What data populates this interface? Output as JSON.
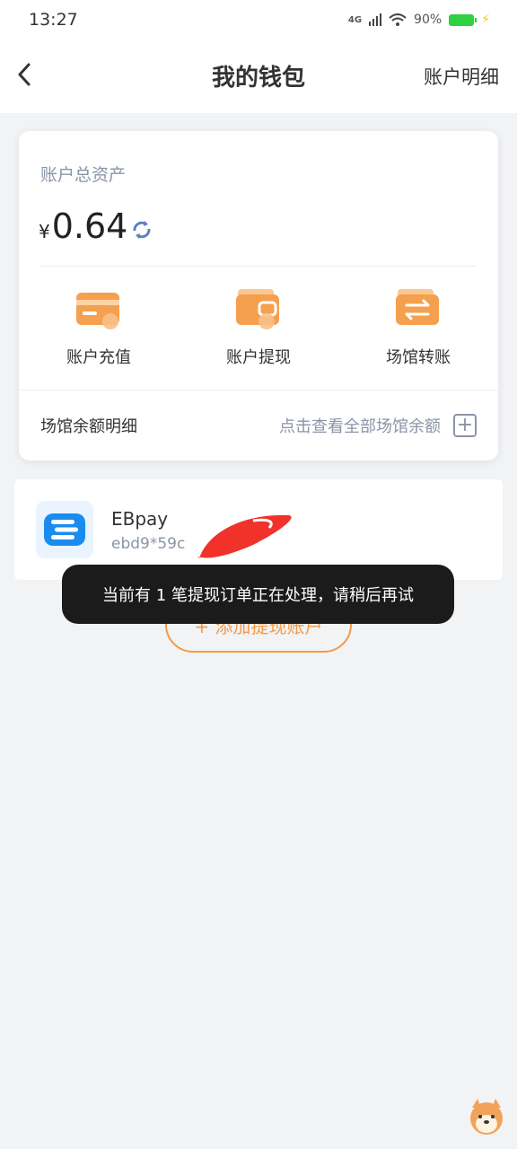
{
  "status_bar": {
    "time": "13:27",
    "network": "4G",
    "battery": "90%"
  },
  "header": {
    "title": "我的钱包",
    "right_link": "账户明细"
  },
  "wallet": {
    "asset_label": "账户总资产",
    "currency_symbol": "¥",
    "amount": "0.64",
    "actions": [
      {
        "label": "账户充值",
        "icon": "card-icon"
      },
      {
        "label": "账户提现",
        "icon": "wallet-icon"
      },
      {
        "label": "场馆转账",
        "icon": "transfer-icon"
      }
    ],
    "venue_label": "场馆余额明细",
    "venue_link": "点击查看全部场馆余额"
  },
  "account": {
    "name": "EBpay",
    "id": "ebd9*59c"
  },
  "add_account_label": "+ 添加提现账户",
  "toast": "当前有 1 笔提现订单正在处理，请稍后再试",
  "colors": {
    "accent_orange": "#f29a4a",
    "muted_text": "#8a94a6",
    "page_bg": "#f2f3f5"
  }
}
